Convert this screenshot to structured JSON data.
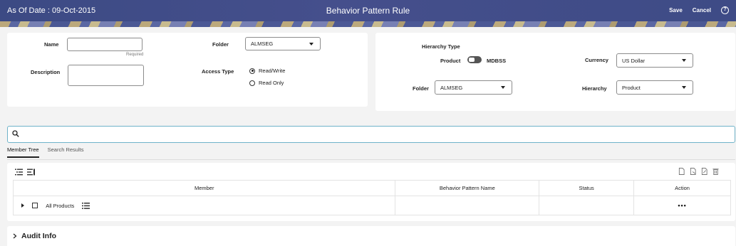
{
  "header": {
    "as_of_date": "As Of Date : 09-Oct-2015",
    "title": "Behavior Pattern Rule",
    "save_label": "Save",
    "cancel_label": "Cancel",
    "help_icon": "?"
  },
  "form_left": {
    "name_label": "Name",
    "name_value": "",
    "required_text": "Required",
    "description_label": "Description",
    "description_value": "",
    "folder_label": "Folder",
    "folder_value": "ALMSEG",
    "access_type_label": "Access Type",
    "access_options": [
      "Read/Write",
      "Read Only"
    ],
    "access_selected": "Read/Write"
  },
  "form_right": {
    "hierarchy_type_label": "Hierarchy Type",
    "toggle_left_label": "Product",
    "toggle_right_label": "MDBSS",
    "currency_label": "Currency",
    "currency_value": "US Dollar",
    "folder_label": "Folder",
    "folder_value": "ALMSEG",
    "hierarchy_label": "Hierarchy",
    "hierarchy_value": "Product"
  },
  "search": {
    "placeholder": ""
  },
  "tabs": [
    {
      "label": "Member Tree",
      "active": true
    },
    {
      "label": "Search Results",
      "active": false
    }
  ],
  "tree_table": {
    "columns": [
      "Member",
      "Behavior Pattern Name",
      "Status",
      "Action"
    ],
    "rows": [
      {
        "member": "All Products",
        "behavior_pattern_name": "",
        "status": "",
        "action": "•••"
      }
    ]
  },
  "audit": {
    "label": "Audit Info"
  },
  "icons": {
    "expand_all": "expand-all-icon",
    "collapse_all": "collapse-all-icon",
    "toolbar": [
      "add-icon",
      "view-icon",
      "edit-icon",
      "delete-icon"
    ]
  },
  "colors": {
    "header": "#414d89",
    "accent": "#6fb3c9"
  }
}
